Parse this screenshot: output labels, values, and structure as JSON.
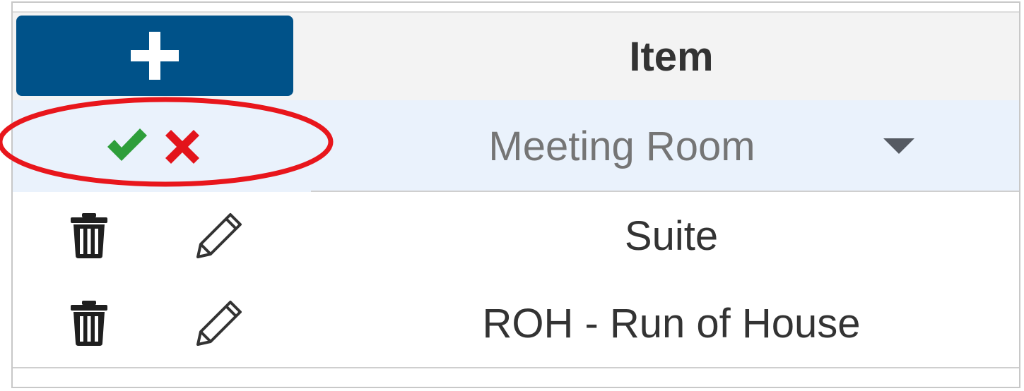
{
  "header": {
    "add_button_icon": "plus-icon",
    "column_title": "Item"
  },
  "edit_row": {
    "confirm_icon": "check-icon",
    "cancel_icon": "close-icon",
    "selected_value": "Meeting Room",
    "dropdown_icon": "caret-down-icon"
  },
  "rows": [
    {
      "label": "Suite",
      "delete_icon": "trash-icon",
      "edit_icon": "pencil-icon"
    },
    {
      "label": "ROH - Run of House",
      "delete_icon": "trash-icon",
      "edit_icon": "pencil-icon"
    }
  ],
  "colors": {
    "primary": "#005289",
    "confirm": "#2e9e3a",
    "cancel": "#e3141b",
    "annotation": "#e8161c",
    "edit_row_bg": "#eaf2fc",
    "header_bg": "#f3f3f3"
  }
}
